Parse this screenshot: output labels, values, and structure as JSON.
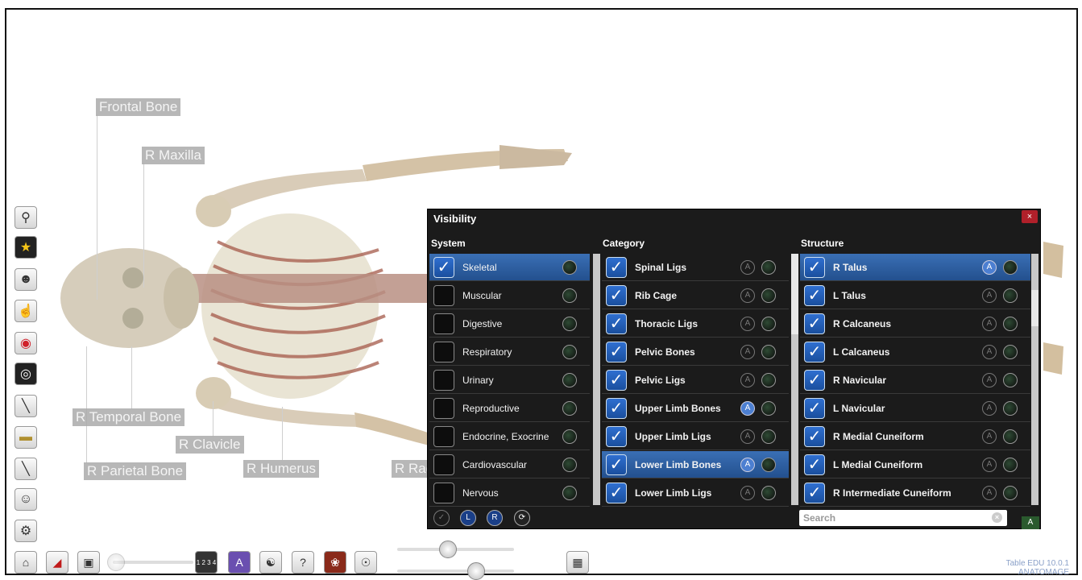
{
  "labels": {
    "frontal": "Frontal Bone",
    "maxilla": "R Maxilla",
    "temporal": "R Temporal Bone",
    "parietal": "R Parietal Bone",
    "clavicle": "R Clavicle",
    "humerus": "R Humerus",
    "radius": "R Rad"
  },
  "left_toolbar": [
    "search-icon",
    "star-icon",
    "face-icon",
    "hand-icon",
    "record-icon",
    "dial-icon",
    "scalpel-icon",
    "ruler-icon",
    "probe-icon",
    "compare-icon",
    "gear-icon"
  ],
  "bottom_toolbar": [
    "home-icon",
    "slice-icon",
    "table-icon",
    "fraction-icon",
    "font-icon",
    "brain-icon",
    "quiz-icon",
    "tissue-icon",
    "eye-icon",
    "grid-icon"
  ],
  "fraction_text": "1 2 3 4",
  "panel": {
    "title": "Visibility",
    "close": "×",
    "headers": {
      "system": "System",
      "category": "Category",
      "structure": "Structure"
    },
    "system": [
      {
        "label": "Skeletal",
        "checked": true,
        "selected": true
      },
      {
        "label": "Muscular",
        "checked": false
      },
      {
        "label": "Digestive",
        "checked": false
      },
      {
        "label": "Respiratory",
        "checked": false
      },
      {
        "label": "Urinary",
        "checked": false
      },
      {
        "label": "Reproductive",
        "checked": false
      },
      {
        "label": "Endocrine, Exocrine",
        "checked": false
      },
      {
        "label": "Cardiovascular",
        "checked": false
      },
      {
        "label": "Nervous",
        "checked": false
      }
    ],
    "category": [
      {
        "label": "Spinal Ligs",
        "a": false
      },
      {
        "label": "Rib Cage",
        "a": false
      },
      {
        "label": "Thoracic Ligs",
        "a": false
      },
      {
        "label": "Pelvic Bones",
        "a": false
      },
      {
        "label": "Pelvic Ligs",
        "a": false
      },
      {
        "label": "Upper Limb Bones",
        "a": true
      },
      {
        "label": "Upper Limb Ligs",
        "a": false
      },
      {
        "label": "Lower Limb Bones",
        "a": true,
        "selected": true
      },
      {
        "label": "Lower Limb Ligs",
        "a": false
      }
    ],
    "structure": [
      {
        "label": "R Talus",
        "a": true,
        "selected": true
      },
      {
        "label": "L Talus",
        "a": false
      },
      {
        "label": "R Calcaneus",
        "a": false
      },
      {
        "label": "L Calcaneus",
        "a": false
      },
      {
        "label": "R Navicular",
        "a": false
      },
      {
        "label": "L Navicular",
        "a": false
      },
      {
        "label": "R Medial Cuneiform",
        "a": false
      },
      {
        "label": "L Medial Cuneiform",
        "a": false
      },
      {
        "label": "R Intermediate Cuneiform",
        "a": false
      }
    ],
    "a_letter": "A",
    "check_mark": "✓",
    "footer": {
      "l": "L",
      "r": "R"
    },
    "search_placeholder": "Search",
    "corner": "A"
  },
  "version": {
    "line1": "Table EDU 10.0.1",
    "line2": "ANATOMAGE"
  }
}
